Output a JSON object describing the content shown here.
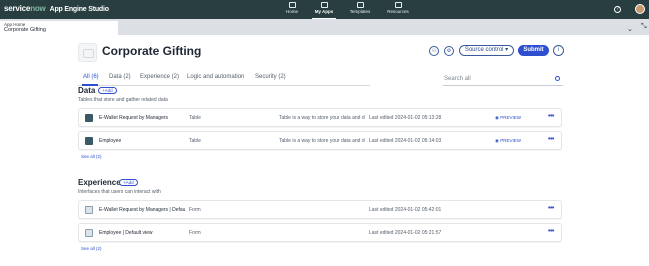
{
  "brand": {
    "name_a": "service",
    "name_b": "now",
    "product": "App Engine Studio"
  },
  "nav": [
    {
      "label": "Home",
      "icon": "home-icon"
    },
    {
      "label": "My Apps",
      "icon": "apps-icon"
    },
    {
      "label": "Templates",
      "icon": "templates-icon"
    },
    {
      "label": "Resources",
      "icon": "resources-icon"
    }
  ],
  "apptab": {
    "label": "App Home",
    "title": "Corporate Gifting"
  },
  "app": {
    "title": "Corporate Gifting",
    "source_control": "Source control ▾",
    "submit": "Submit"
  },
  "tabs": [
    "All (6)",
    "Data (2)",
    "Experience (2)",
    "Logic and automation",
    "Security (2)"
  ],
  "search": {
    "placeholder": "Search all"
  },
  "data_section": {
    "title": "Data",
    "add": "+Add",
    "desc": "Tables that store and gather related data",
    "rows": [
      {
        "name": "E-Wallet Request by Managers",
        "type": "Table",
        "desc": "Table is a way to store your data and def...",
        "edited": "Last edited 2024-01-02 05:13:28",
        "preview": "PREVIEW"
      },
      {
        "name": "Employee",
        "type": "Table",
        "desc": "Table is a way to store your data and def...",
        "edited": "Last edited 2024-01-02 05:14:03",
        "preview": "PREVIEW"
      }
    ],
    "see_all": "See all (2)"
  },
  "experience_section": {
    "title": "Experience",
    "add": "+Add",
    "desc": "Interfaces that users can interact with",
    "rows": [
      {
        "name": "E-Wallet Request by Managers | Default...",
        "type": "Form",
        "edited": "Last edited 2024-01-02 05:42:01"
      },
      {
        "name": "Employee | Default view",
        "type": "Form",
        "edited": "Last edited 2024-01-02 05:21:57"
      }
    ],
    "see_all": "See all (2)"
  },
  "colors": {
    "topbar": "#293e40",
    "accent": "#2e4fcf",
    "brand_green": "#81b5a1"
  }
}
